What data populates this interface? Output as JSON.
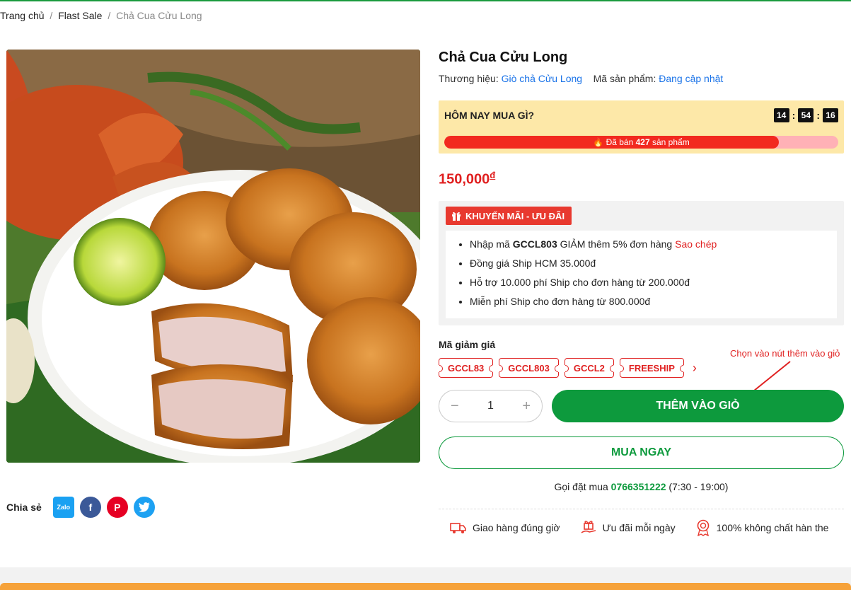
{
  "breadcrumb": {
    "home": "Trang chủ",
    "sep1": "/",
    "category": "Flast Sale",
    "sep2": "/",
    "current": "Chả Cua Cửu Long"
  },
  "product": {
    "title": "Chả Cua Cửu Long",
    "brand_label": "Thương hiệu:",
    "brand": "Giò chả Cửu Long",
    "sku_label": "Mã sản phẩm:",
    "sku": "Đang cập nhật",
    "price": "150,000",
    "currency": "đ"
  },
  "flash_sale": {
    "heading": "HÔM NAY MUA GÌ?",
    "timer": {
      "hours": "14",
      "minutes": "54",
      "seconds": "16"
    },
    "sold_prefix": "🔥 Đã bán",
    "sold_count": "427",
    "sold_suffix": "sản phẩm",
    "progress_fraction": 0.85
  },
  "promo": {
    "badge": "KHUYẾN MÃI - ƯU ĐÃI",
    "line1_pre": "Nhập mã",
    "line1_code": "GCCL803",
    "line1_post": "GIẢM thêm 5% đơn hàng",
    "line1_copy": "Sao chép",
    "line2": "Đồng giá Ship HCM 35.000đ",
    "line3": "Hỗ trợ 10.000 phí Ship cho đơn hàng từ 200.000đ",
    "line4": "Miễn phí Ship cho đơn hàng từ 800.000đ"
  },
  "coupons": {
    "label": "Mã giảm giá",
    "items": [
      "GCCL83",
      "GCCL803",
      "GCCL2",
      "FREESHIP"
    ]
  },
  "annotation": "Chọn vào nút thêm vào giỏ",
  "cart": {
    "minus": "−",
    "quantity": "1",
    "plus": "+",
    "add_to_cart": "THÊM VÀO GIỎ",
    "buy_now": "MUA NGAY"
  },
  "call": {
    "prefix": "Gọi đặt mua",
    "phone": "0766351222",
    "hours": "(7:30 - 19:00)"
  },
  "benefits": [
    "Giao hàng đúng giờ",
    "Ưu đãi mỗi ngày",
    "100% không chất hàn the"
  ],
  "share": {
    "label": "Chia sẻ",
    "zalo": "Zalo",
    "facebook": "f",
    "pinterest": "P"
  },
  "colors": {
    "green": "#0d9a3d",
    "red": "#e02020",
    "link": "#1a73e8",
    "flash_bg": "#fde8a8"
  }
}
